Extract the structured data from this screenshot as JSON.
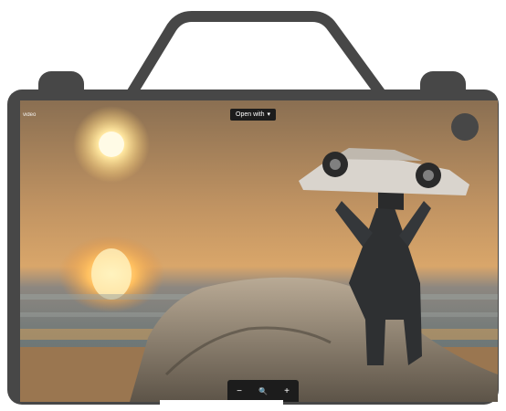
{
  "viewer": {
    "corner_label": "video",
    "top_pill_label": "Open with",
    "top_pill_arrow": "▾",
    "zoom_out_symbol": "−",
    "zoom_reset_symbol": "🔍",
    "zoom_in_symbol": "+"
  },
  "colors": {
    "camera_body": "#474747",
    "toolbar_bg": "#1c1c1c",
    "sky_top": "#8f7354",
    "sun": "#fff6c4",
    "sea": "#6f7a7a"
  },
  "icons": {
    "zoom_out": "minus-icon",
    "zoom_reset": "magnifier-icon",
    "zoom_in": "plus-icon",
    "shutter": "record-dot-icon"
  }
}
